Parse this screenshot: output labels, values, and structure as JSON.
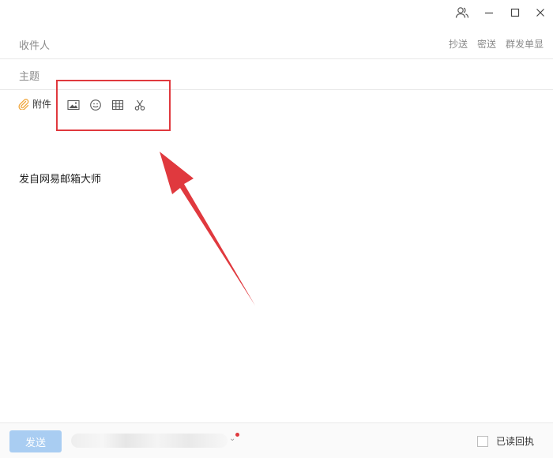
{
  "window": {
    "icons": [
      "contacts-icon",
      "minimize-icon",
      "maximize-icon",
      "close-icon"
    ]
  },
  "compose": {
    "to_label": "收件人",
    "cc_label": "抄送",
    "bcc_label": "密送",
    "separate_send_label": "群发单显",
    "subject_label": "主题",
    "attachment_label": "附件",
    "toolbar_icons": [
      "image-icon",
      "emoji-icon",
      "table-icon",
      "scissors-icon"
    ],
    "signature": "发自网易邮箱大师"
  },
  "footer": {
    "send_label": "发送",
    "read_receipt_label": "已读回执",
    "read_receipt_checked": false
  },
  "annotation": {
    "color": "#e0393e"
  }
}
